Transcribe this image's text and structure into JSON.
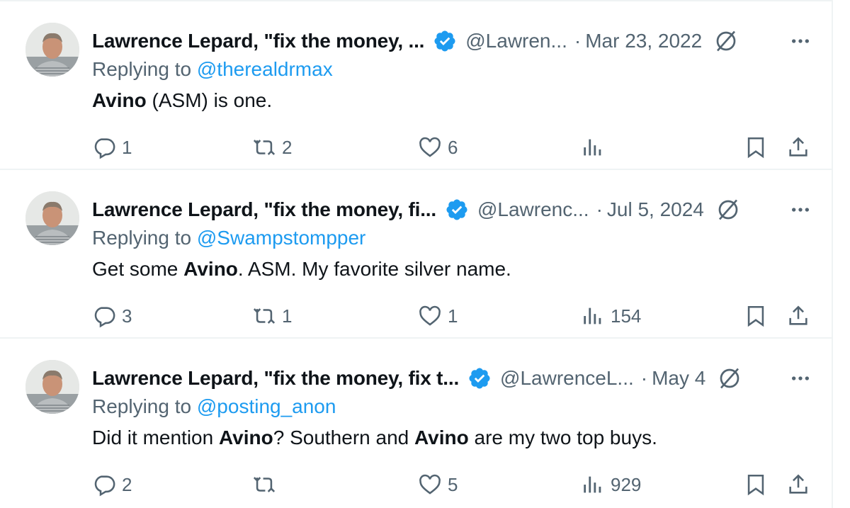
{
  "colors": {
    "accent": "#1d9bf0",
    "muted": "#536471",
    "text": "#0f1419",
    "divider": "#eff3f4"
  },
  "tweets": [
    {
      "name": "Lawrence Lepard, \"fix the money, ...",
      "handle": "@Lawren...",
      "dot": "·",
      "date": "Mar 23, 2022",
      "replying_prefix": "Replying to ",
      "replying_to": "@therealdrmax",
      "body": [
        {
          "bold": true,
          "text": "Avino"
        },
        {
          "bold": false,
          "text": " (ASM) is one."
        }
      ],
      "replies": "1",
      "reposts": "2",
      "likes": "6",
      "views": ""
    },
    {
      "name": "Lawrence Lepard, \"fix the money, fi...",
      "handle": "@Lawrenc...",
      "dot": "·",
      "date": "Jul 5, 2024",
      "replying_prefix": "Replying to ",
      "replying_to": "@Swampstompper",
      "body": [
        {
          "bold": false,
          "text": "Get some "
        },
        {
          "bold": true,
          "text": "Avino"
        },
        {
          "bold": false,
          "text": ".  ASM.  My favorite silver name."
        }
      ],
      "replies": "3",
      "reposts": "1",
      "likes": "1",
      "views": "154"
    },
    {
      "name": "Lawrence Lepard, \"fix the money, fix t...",
      "handle": "@LawrenceL...",
      "dot": "·",
      "date": "May 4",
      "replying_prefix": "Replying to ",
      "replying_to": "@posting_anon",
      "body": [
        {
          "bold": false,
          "text": "Did it mention "
        },
        {
          "bold": true,
          "text": "Avino"
        },
        {
          "bold": false,
          "text": "? Southern and "
        },
        {
          "bold": true,
          "text": "Avino"
        },
        {
          "bold": false,
          "text": " are my two top buys."
        }
      ],
      "replies": "2",
      "reposts": "",
      "likes": "5",
      "views": "929"
    }
  ],
  "icons": {
    "verified": "verified-badge-icon",
    "grok": "grok-icon",
    "more": "more-options-icon",
    "reply": "reply-icon",
    "repost": "repost-icon",
    "like": "heart-icon",
    "views": "views-icon",
    "bookmark": "bookmark-icon",
    "share": "share-icon"
  }
}
